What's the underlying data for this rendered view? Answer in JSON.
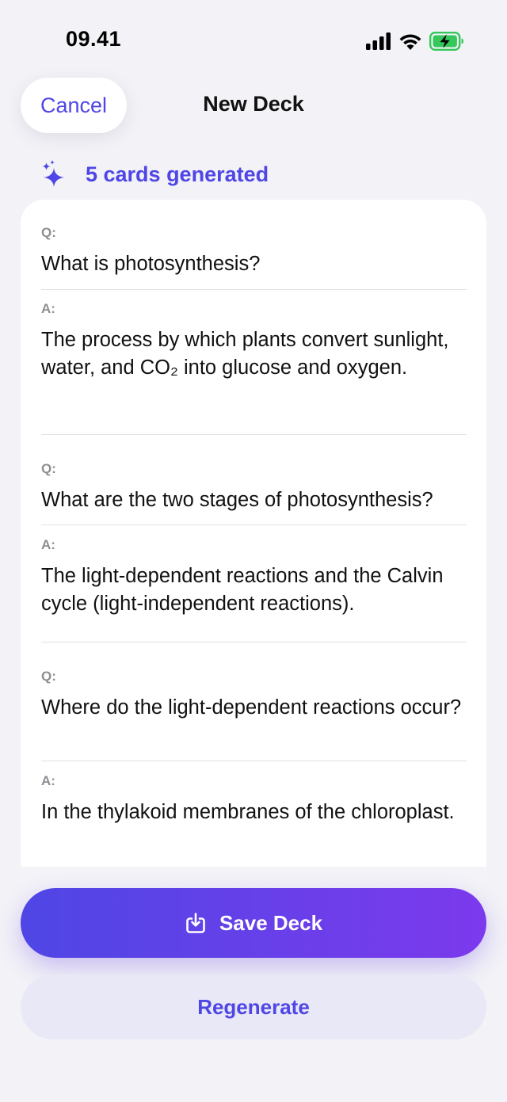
{
  "status": {
    "time": "09.41"
  },
  "nav": {
    "cancel_label": "Cancel",
    "title": "New Deck"
  },
  "generation": {
    "text": "5 cards generated"
  },
  "labels": {
    "question": "Q:",
    "answer": "A:"
  },
  "cards": [
    {
      "question": "What is photosynthesis?",
      "answer": "The process by which plants convert sunlight, water, and CO₂ into glucose and oxygen."
    },
    {
      "question": "What are the two stages of photosynthesis?",
      "answer": "The light-dependent reactions and the Calvin cycle (light-independent reactions)."
    },
    {
      "question": "Where do the light-dependent reactions occur?",
      "answer": "In the thylakoid membranes of the chloroplast."
    }
  ],
  "actions": {
    "save_label": "Save Deck",
    "regenerate_label": "Regenerate"
  },
  "colors": {
    "accent": "#4f46e5",
    "gradient_end": "#7c3aed",
    "battery": "#34c759",
    "background": "#f2f2f7",
    "secondary_button_bg": "#e8e8f7"
  },
  "icons": {
    "signal": "cellular-signal-icon",
    "wifi": "wifi-icon",
    "battery": "battery-charging-icon",
    "sparkle": "sparkles-icon",
    "save": "download-tray-icon"
  }
}
